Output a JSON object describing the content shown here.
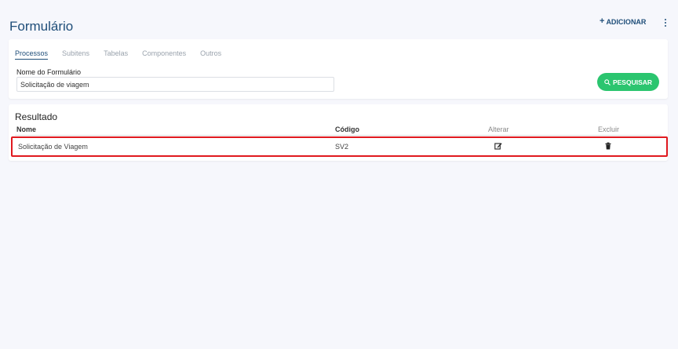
{
  "header": {
    "title": "Formulário",
    "add_label": "ADICIONAR",
    "add_icon": "plus-icon",
    "more_icon": "more-vertical-icon"
  },
  "search": {
    "tabs": [
      {
        "label": "Processos",
        "active": true
      },
      {
        "label": "Subitens",
        "active": false
      },
      {
        "label": "Tabelas",
        "active": false
      },
      {
        "label": "Componentes",
        "active": false
      },
      {
        "label": "Outros",
        "active": false
      }
    ],
    "field_label": "Nome do Formulário",
    "field_value": "Solicitação de viagem",
    "button_label": "PESQUISAR",
    "button_icon": "search-icon",
    "button_color": "#2bc56f"
  },
  "result": {
    "title": "Resultado",
    "columns": [
      "Nome",
      "Código",
      "Alterar",
      "Excluir"
    ],
    "rows": [
      {
        "nome": "Solicitação de Viagem",
        "codigo": "SV2",
        "alterar_icon": "edit-icon",
        "excluir_icon": "trash-icon"
      }
    ],
    "highlight_color": "#e0191f"
  },
  "colors": {
    "accent": "#1f4e79",
    "background": "#f6f7fc"
  }
}
